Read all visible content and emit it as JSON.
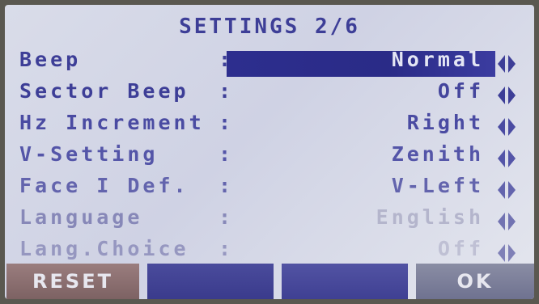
{
  "title": "SETTINGS 2/6",
  "rows": [
    {
      "label": "Beep",
      "value": "Normal"
    },
    {
      "label": "Sector Beep",
      "value": "Off"
    },
    {
      "label": "Hz Increment",
      "value": "Right"
    },
    {
      "label": "V-Setting",
      "value": "Zenith"
    },
    {
      "label": "Face I Def.",
      "value": "V-Left"
    },
    {
      "label": "Language",
      "value": "English"
    },
    {
      "label": "Lang.Choice",
      "value": "Off"
    }
  ],
  "colon": ":",
  "buttons": {
    "f1": "RESET",
    "f2": "",
    "f3": "",
    "f4": "OK"
  },
  "colors": {
    "text": "#3d3e97",
    "selection": "#2d2e8e",
    "softkey": "#3a3b8c",
    "reset_key": "#8a6d6e",
    "ok_key": "#7a7d96"
  }
}
